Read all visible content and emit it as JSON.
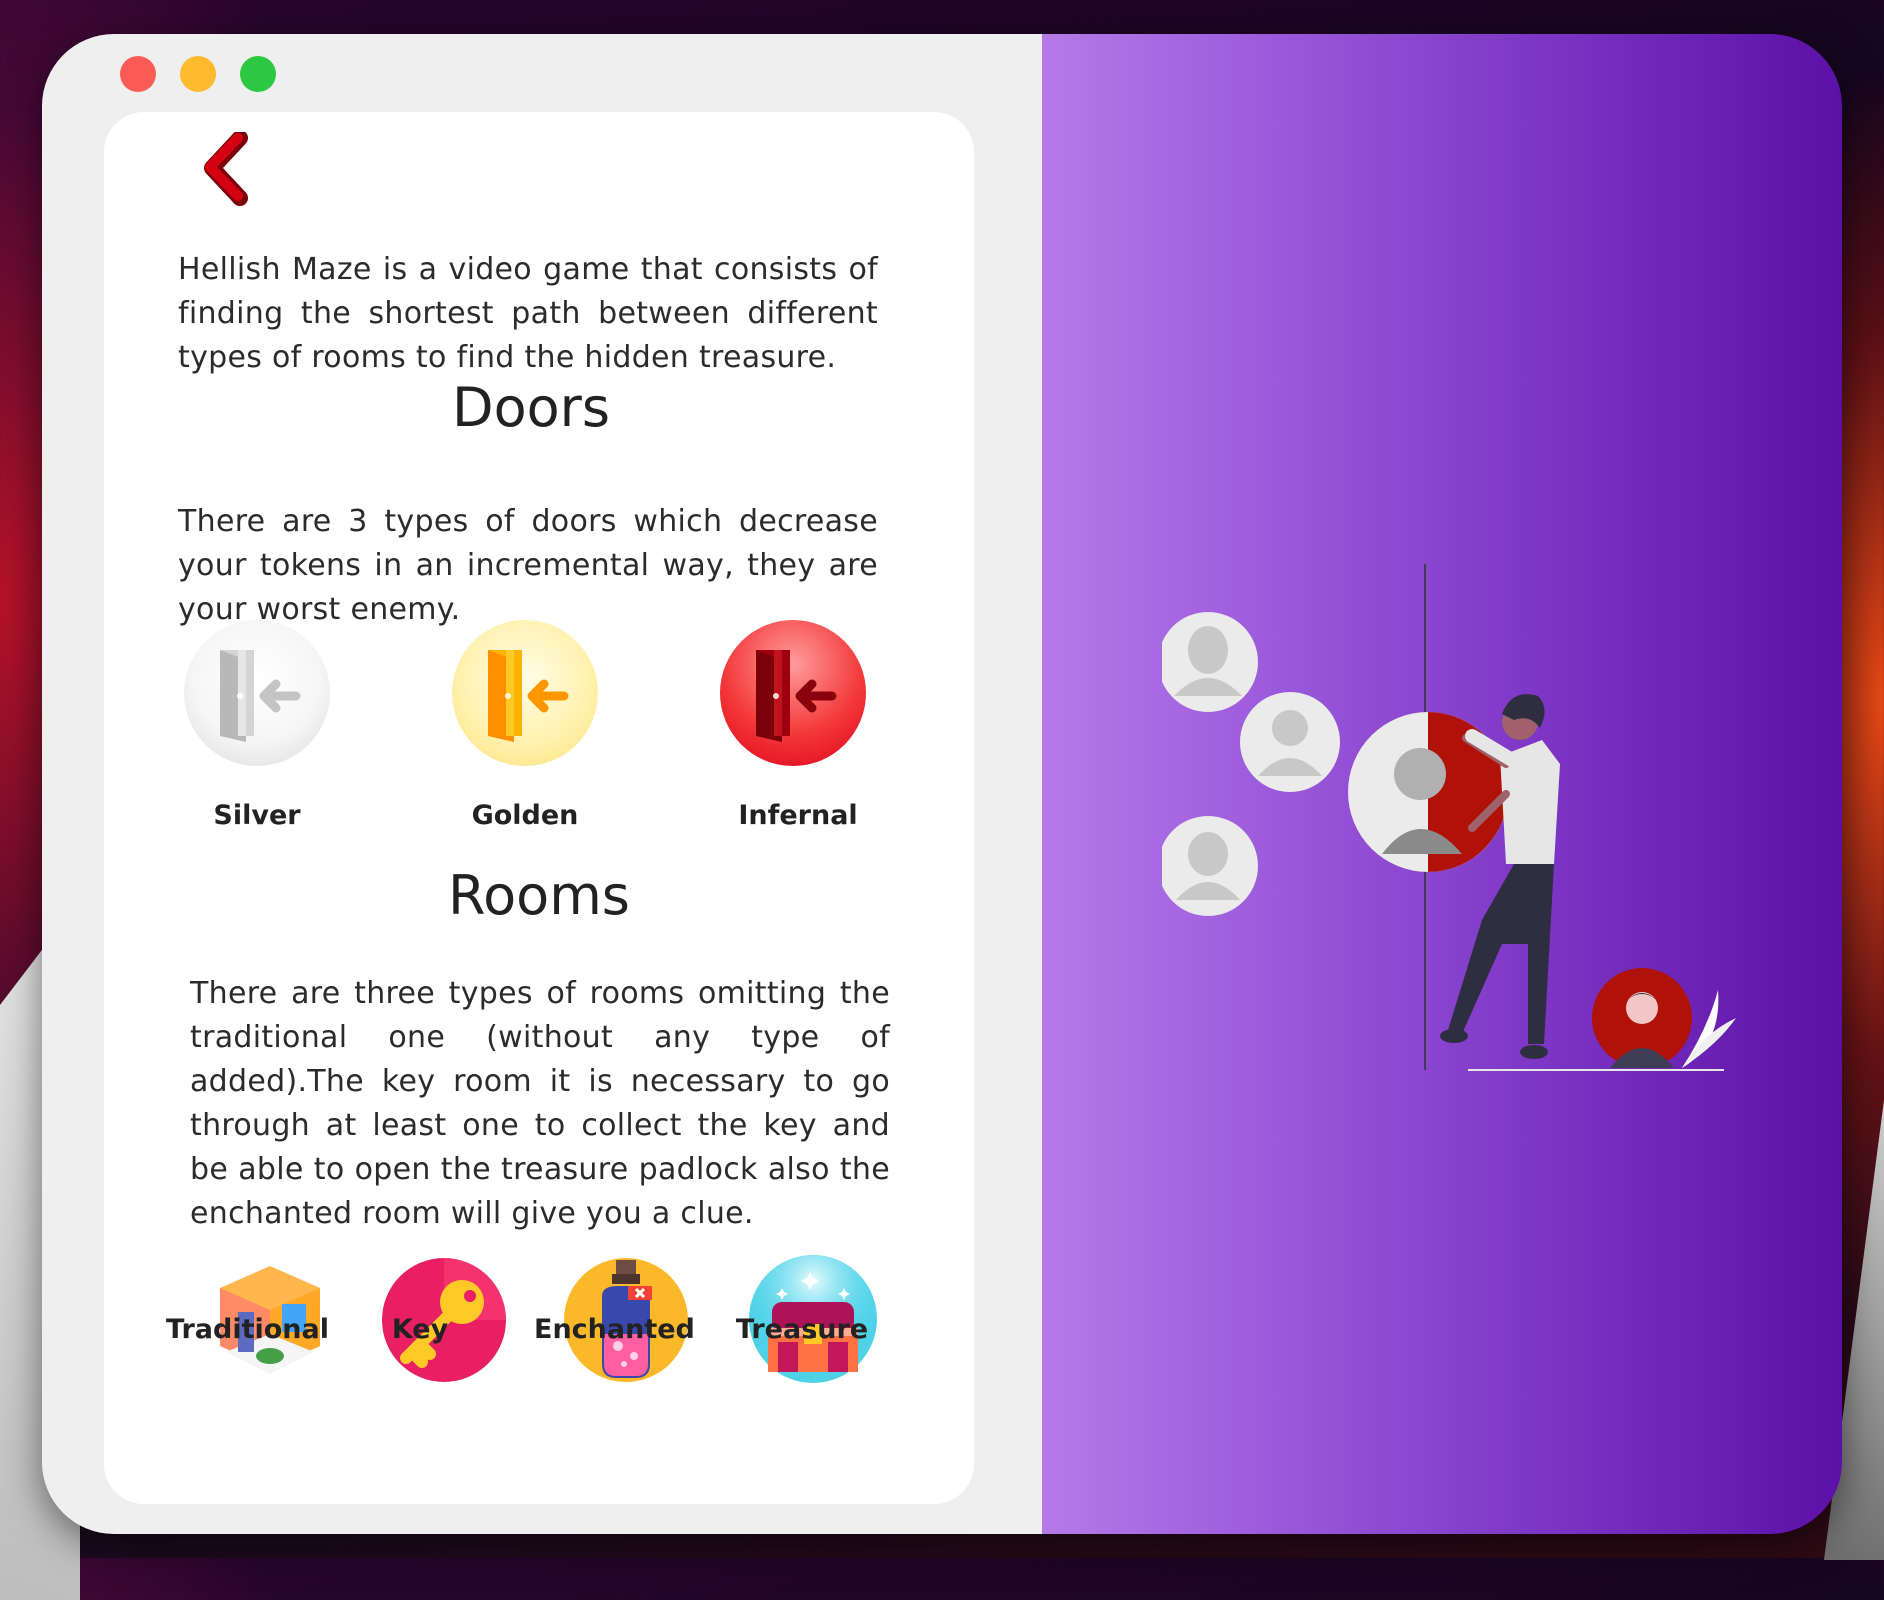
{
  "window": {
    "traffic_lights": [
      "close",
      "minimize",
      "maximize"
    ]
  },
  "content": {
    "back_icon": "chevron-left-icon",
    "intro": "Hellish Maze is a video game that consists of finding the shortest path between different types of rooms to find the hidden treasure.",
    "doors": {
      "heading": "Doors",
      "description": "There are 3 types of doors which decrease your tokens in an incremental way, they are your worst enemy.",
      "items": [
        {
          "label": "Silver",
          "icon": "silver-door-icon",
          "color": "#c9c9c9"
        },
        {
          "label": "Golden",
          "icon": "golden-door-icon",
          "color": "#ff9800"
        },
        {
          "label": "Infernal",
          "icon": "infernal-door-icon",
          "color": "#b3000f"
        }
      ]
    },
    "rooms": {
      "heading": "Rooms",
      "description": "There are three types of rooms omitting the traditional one (without any type of added).The key room it is necessary to go through at least one to collect the key and be able to open the treasure padlock also the enchanted room will give you a clue.",
      "items": [
        {
          "label": "Traditional",
          "icon": "traditional-room-icon"
        },
        {
          "label": "Key",
          "icon": "key-icon"
        },
        {
          "label": "Enchanted",
          "icon": "potion-icon"
        },
        {
          "label": "Treasure",
          "icon": "treasure-chest-icon"
        }
      ]
    }
  },
  "colors": {
    "accent_red": "#c40010",
    "gradient_start": "#b57ae8",
    "gradient_end": "#5b10a6"
  }
}
